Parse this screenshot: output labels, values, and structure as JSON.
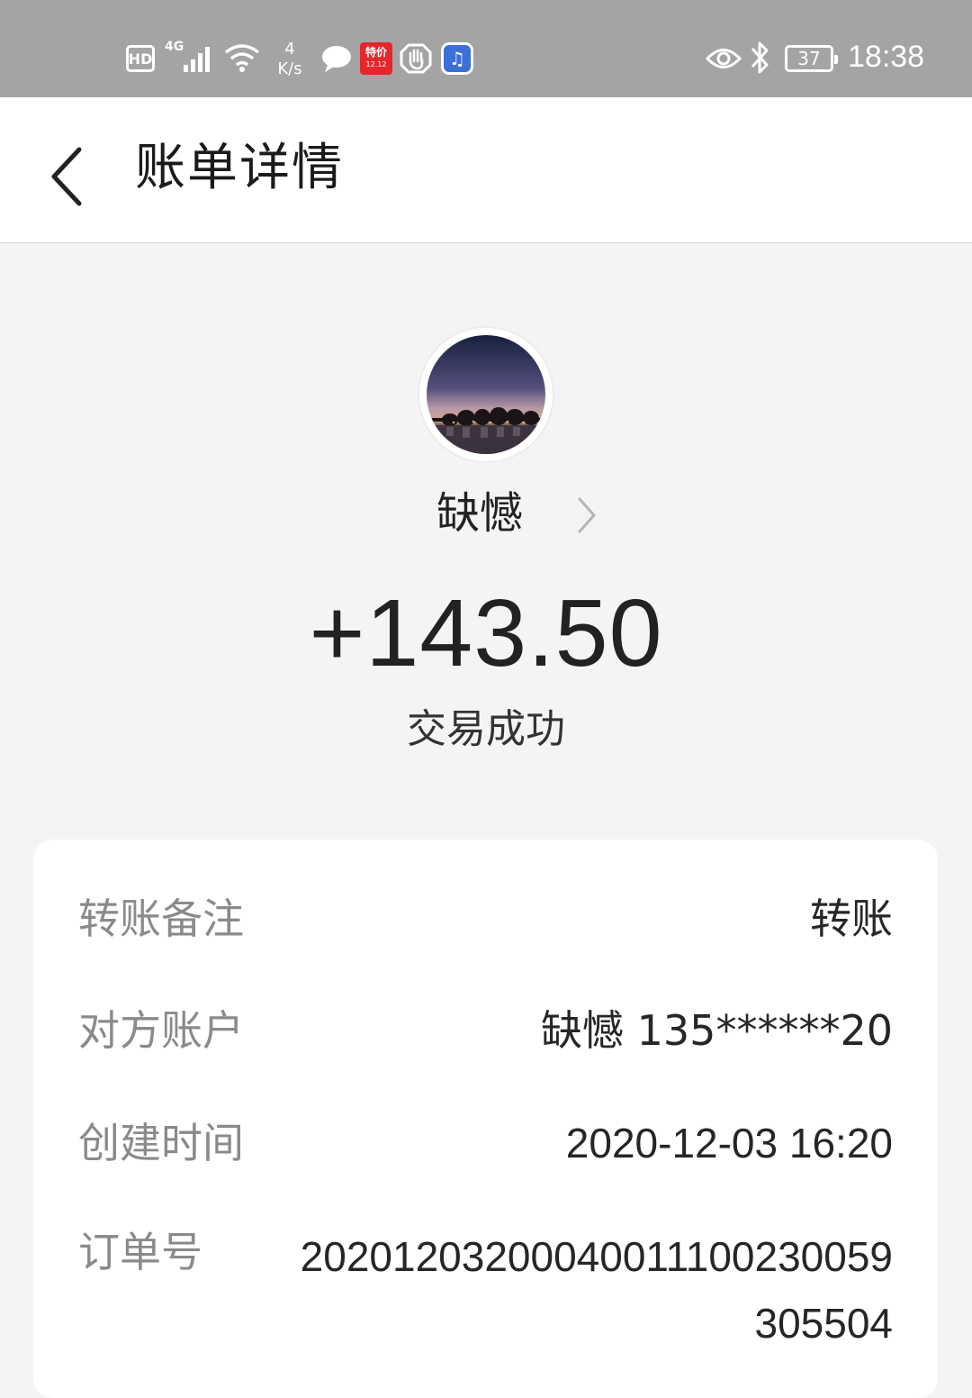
{
  "status_bar": {
    "hd": "HD",
    "network": "4G",
    "speed_value": "4",
    "speed_unit": "K/s",
    "promo_label": "特价",
    "promo_date": "12.12",
    "battery": "37",
    "time": "18:38"
  },
  "header": {
    "title": "账单详情"
  },
  "transaction": {
    "payee": "缺憾",
    "amount": "+143.50",
    "status": "交易成功"
  },
  "details": {
    "remark_label": "转账备注",
    "remark_value": "转账",
    "account_label": "对方账户",
    "account_value": "缺憾 135******20",
    "created_label": "创建时间",
    "created_value": "2020-12-03 16:20",
    "order_label": "订单号",
    "order_value": "20201203200040011100230059305504"
  },
  "colors": {
    "status_bar_bg": "#a4a4a4",
    "page_bg": "#f4f4f4",
    "card_bg": "#ffffff",
    "label_text": "#8a8a8a",
    "value_text": "#262626"
  }
}
